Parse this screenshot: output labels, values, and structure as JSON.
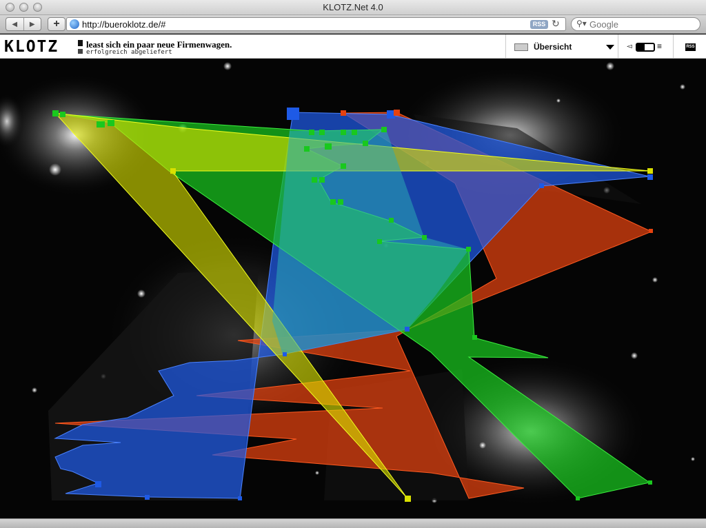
{
  "window": {
    "title": "KLOTZ.Net 4.0"
  },
  "toolbar": {
    "back_label": "◀",
    "forward_label": "▶",
    "add_label": "+",
    "url": "http://bueroklotz.de/#",
    "rss_label": "RSS",
    "reload_label": "↻",
    "search_placeholder": "Google"
  },
  "site": {
    "logo": "KLOTZ",
    "headline": "least sich ein paar neue Firmenwagen.",
    "subline": "erfolgreich abgeliefert",
    "dropdown_label": "Übersicht",
    "view_left_icon": "◅",
    "view_right_icon": "≡",
    "rss_label": "RSS"
  },
  "colors": {
    "yellow": "#d9e000",
    "green": "#19c81e",
    "blue": "#1e5ae6",
    "orange": "#e6420f",
    "cyan": "#2aaab4",
    "background": "#000000"
  },
  "icons": {
    "search": "magnifier-icon",
    "globe": "globe-icon",
    "rss": "rss-icon"
  }
}
